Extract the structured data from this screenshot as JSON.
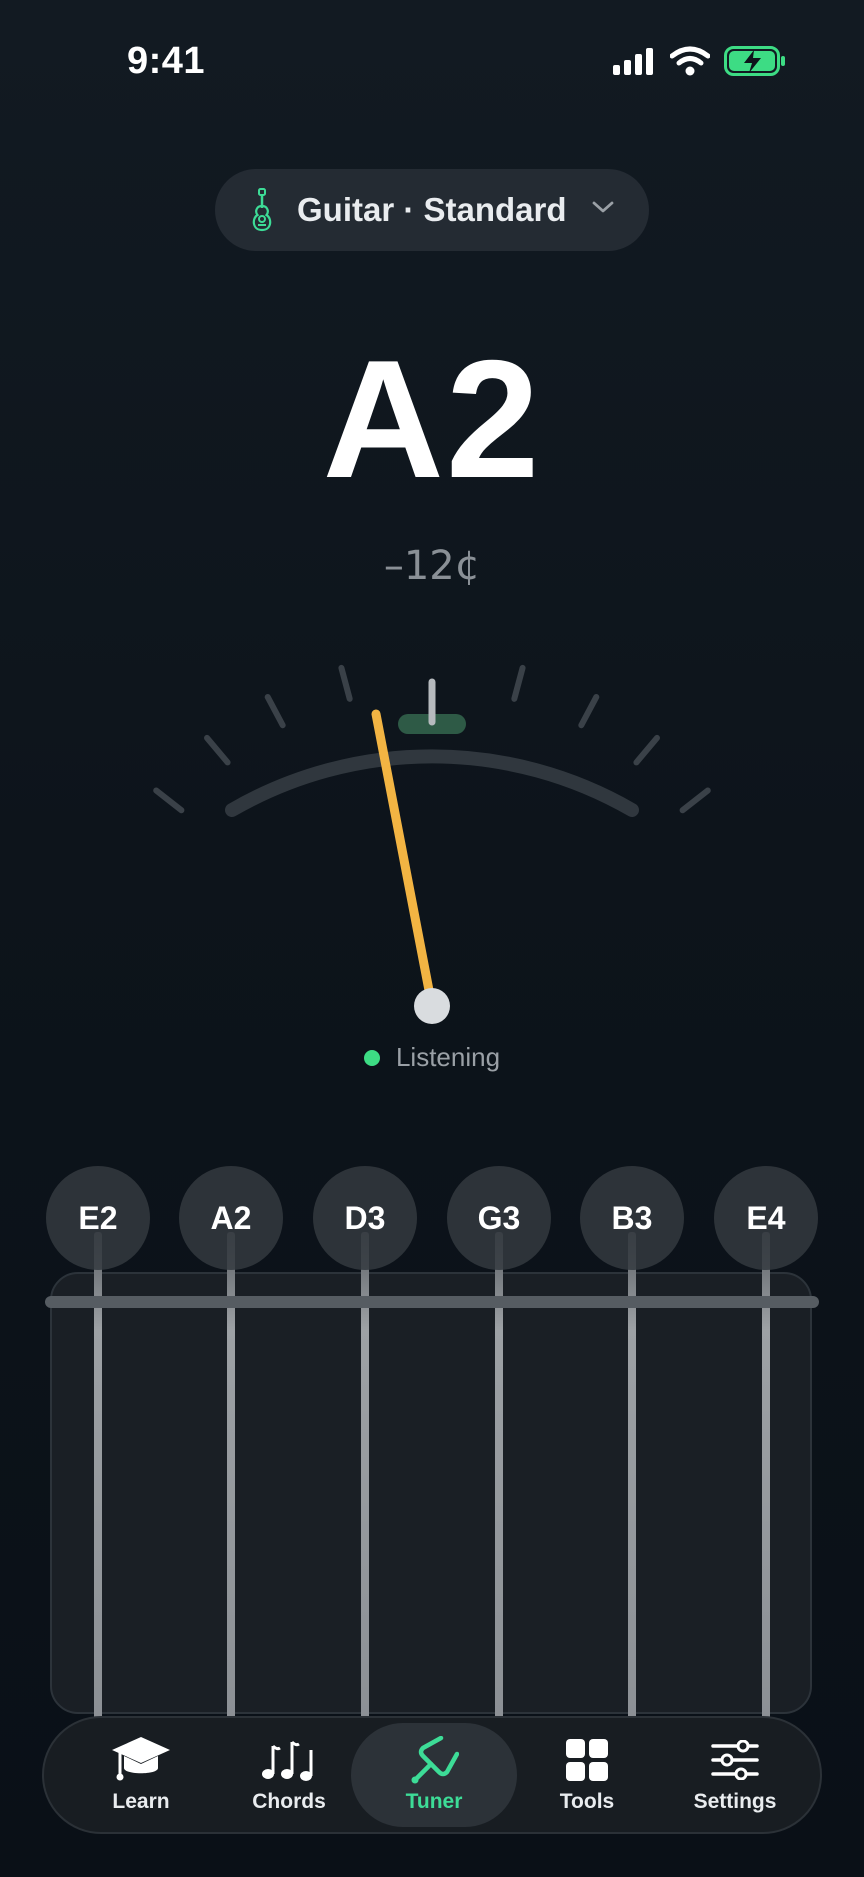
{
  "status": {
    "time": "9:41"
  },
  "tuning": {
    "label": "Guitar · Standard"
  },
  "tuner": {
    "note": "A2",
    "cents_label": "–12¢",
    "cents_value": -12,
    "status": "Listening"
  },
  "strings": [
    "E2",
    "A2",
    "D3",
    "G3",
    "B3",
    "E4"
  ],
  "tabs": [
    {
      "label": "Learn",
      "icon": "graduation-cap-icon"
    },
    {
      "label": "Chords",
      "icon": "music-notes-icon"
    },
    {
      "label": "Tuner",
      "icon": "tuning-fork-icon",
      "active": true
    },
    {
      "label": "Tools",
      "icon": "grid-icon"
    },
    {
      "label": "Settings",
      "icon": "sliders-icon"
    }
  ],
  "colors": {
    "accent": "#3ddc97",
    "needle": "#f2b443",
    "in_tune_zone": "#2e5a46"
  }
}
